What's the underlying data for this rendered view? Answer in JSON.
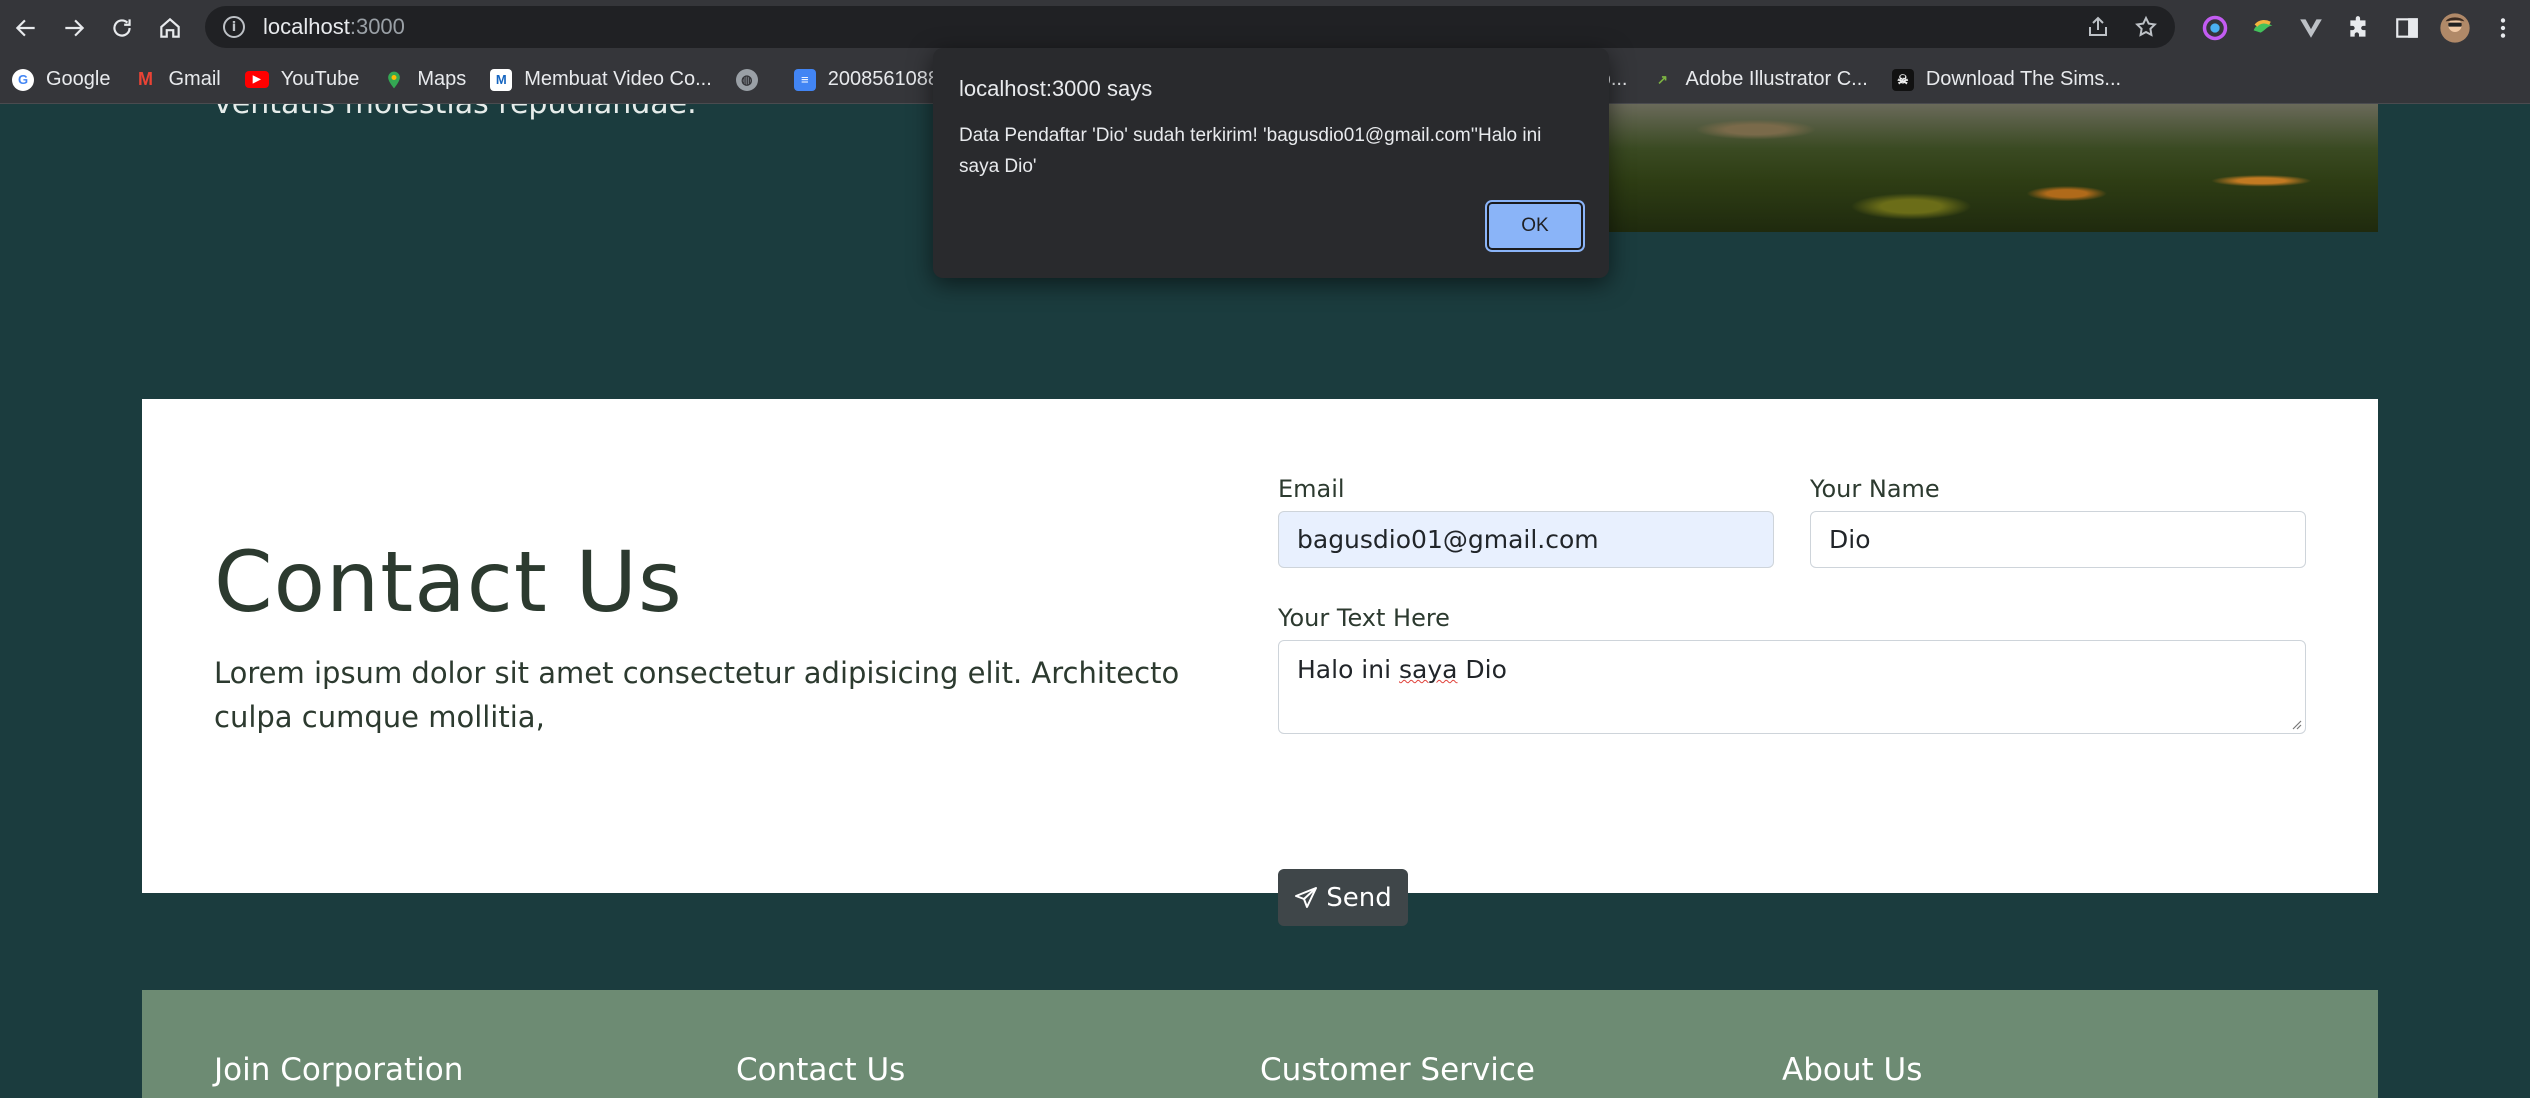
{
  "browser": {
    "url_host": "localhost",
    "url_rest": ":3000",
    "bookmarks": [
      {
        "label": "Google",
        "icon": "google-icon",
        "color": "#4285f4"
      },
      {
        "label": "Gmail",
        "icon": "gmail-icon",
        "color": "#ea4335"
      },
      {
        "label": "YouTube",
        "icon": "youtube-icon",
        "color": "#ff0000"
      },
      {
        "label": "Maps",
        "icon": "maps-icon",
        "color": "#34a853"
      },
      {
        "label": "Membuat Video Co...",
        "icon": "site-icon",
        "color": "#3b78e7"
      },
      {
        "label": "",
        "icon": "globe-icon",
        "color": "#9aa0a6"
      },
      {
        "label": "2008561088_buk",
        "icon": "docs-icon",
        "color": "#4285f4"
      },
      {
        "label": "So...",
        "icon": "site-icon",
        "color": "#5f6368"
      },
      {
        "label": "Adobe Illustrator C...",
        "icon": "chart-icon",
        "color": "#7cb342"
      },
      {
        "label": "Download The Sims...",
        "icon": "skull-icon",
        "color": "#202124"
      }
    ]
  },
  "hero": {
    "text_fragment": "ventatis molestias repudiandae."
  },
  "contact": {
    "title": "Contact Us",
    "description": "Lorem ipsum dolor sit amet consectetur adipisicing elit. Architecto culpa cumque mollitia,",
    "email_label": "Email",
    "email_value": "bagusdio01@gmail.com",
    "name_label": "Your Name",
    "name_value": "Dio",
    "text_label": "Your Text Here",
    "text_value_1": "Halo ini ",
    "text_value_2": "saya",
    "text_value_3": " Dio",
    "send_label": "Send"
  },
  "footer": {
    "columns": [
      "Join Corporation",
      "Contact Us",
      "Customer Service",
      "About Us"
    ]
  },
  "dialog": {
    "title": "localhost:3000 says",
    "message": "Data Pendaftar 'Dio' sudah terkirim! 'bagusdio01@gmail.com''Halo ini saya Dio'",
    "ok_label": "OK"
  },
  "colors": {
    "page_bg": "#1b3c3e",
    "footer_bg": "#6d8b73",
    "send_btn": "#3f4649",
    "ok_btn": "#8ab4f8"
  }
}
